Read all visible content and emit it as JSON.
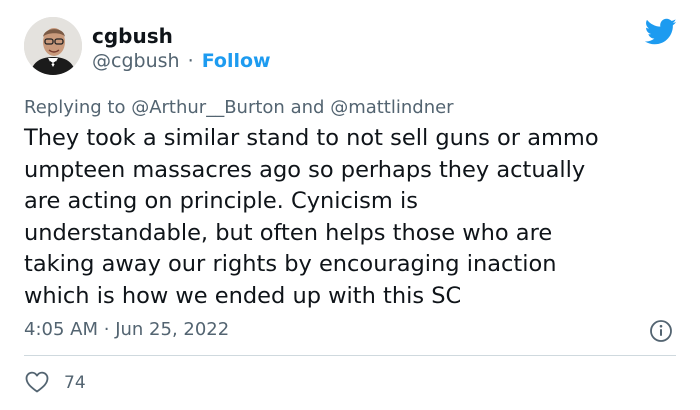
{
  "author": {
    "display_name": "cgbush",
    "handle": "@cgbush",
    "separator": "·",
    "follow_label": "Follow",
    "avatar_icon": "user-photo"
  },
  "brand": {
    "icon": "twitter-bird-icon",
    "color": "#1d9bf0"
  },
  "reply": {
    "prefix": "Replying to",
    "mention_1": "@Arthur__Burton",
    "conjunction": "and",
    "mention_2": "@mattlindner"
  },
  "tweet": {
    "lines": [
      "They took a similar stand to not sell guns or ammo",
      "umpteen massacres ago so perhaps they actually",
      "are acting on principle. Cynicism is",
      "understandable, but often helps those who are",
      "taking away our rights by encouraging inaction",
      "which is how we ended up with this SC"
    ]
  },
  "meta": {
    "time": "4:05 AM",
    "separator": "·",
    "date": "Jun 25, 2022",
    "info_icon": "info-icon"
  },
  "actions": {
    "like_icon": "heart-icon",
    "like_count": "74"
  },
  "colors": {
    "text": "#0f1419",
    "secondary": "#536471",
    "accent": "#1d9bf0",
    "divider": "#cfd9de"
  }
}
